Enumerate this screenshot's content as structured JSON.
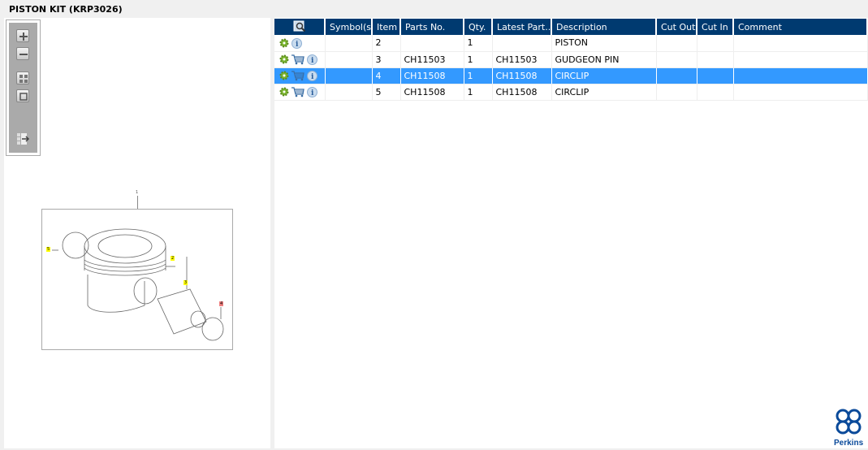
{
  "title": "PISTON KIT (KRP3026)",
  "toolbar": {
    "icons": [
      "zoom-in-icon",
      "zoom-out-icon",
      "fit-all-icon",
      "fit-window-icon",
      "export-icon"
    ]
  },
  "diagram": {
    "callouts": [
      "1",
      "2",
      "3",
      "4",
      "5"
    ],
    "highlight_yellow": "#ffff00",
    "highlight_red": "#f08080"
  },
  "table": {
    "columns": [
      "",
      "Symbol(s)",
      "Item",
      "Parts No.",
      "Qty.",
      "Latest Part...",
      "Description",
      "Cut Out",
      "Cut In",
      "Comment"
    ],
    "rows": [
      {
        "cart": false,
        "item": "2",
        "part": "",
        "qty": "1",
        "latest": "",
        "desc": "PISTON",
        "cutout": "",
        "cutin": "",
        "comment": ""
      },
      {
        "cart": true,
        "item": "3",
        "part": "CH11503",
        "qty": "1",
        "latest": "CH11503",
        "desc": "GUDGEON PIN",
        "cutout": "",
        "cutin": "",
        "comment": ""
      },
      {
        "cart": true,
        "item": "4",
        "part": "CH11508",
        "qty": "1",
        "latest": "CH11508",
        "desc": "CIRCLIP",
        "cutout": "",
        "cutin": "",
        "comment": "",
        "selected": true
      },
      {
        "cart": true,
        "item": "5",
        "part": "CH11508",
        "qty": "1",
        "latest": "CH11508",
        "desc": "CIRCLIP",
        "cutout": "",
        "cutin": "",
        "comment": ""
      }
    ]
  },
  "colors": {
    "header": "#003a70",
    "selected": "#3399ff",
    "brand": "#0a4a9a"
  },
  "logo": {
    "text": "Perkins"
  }
}
